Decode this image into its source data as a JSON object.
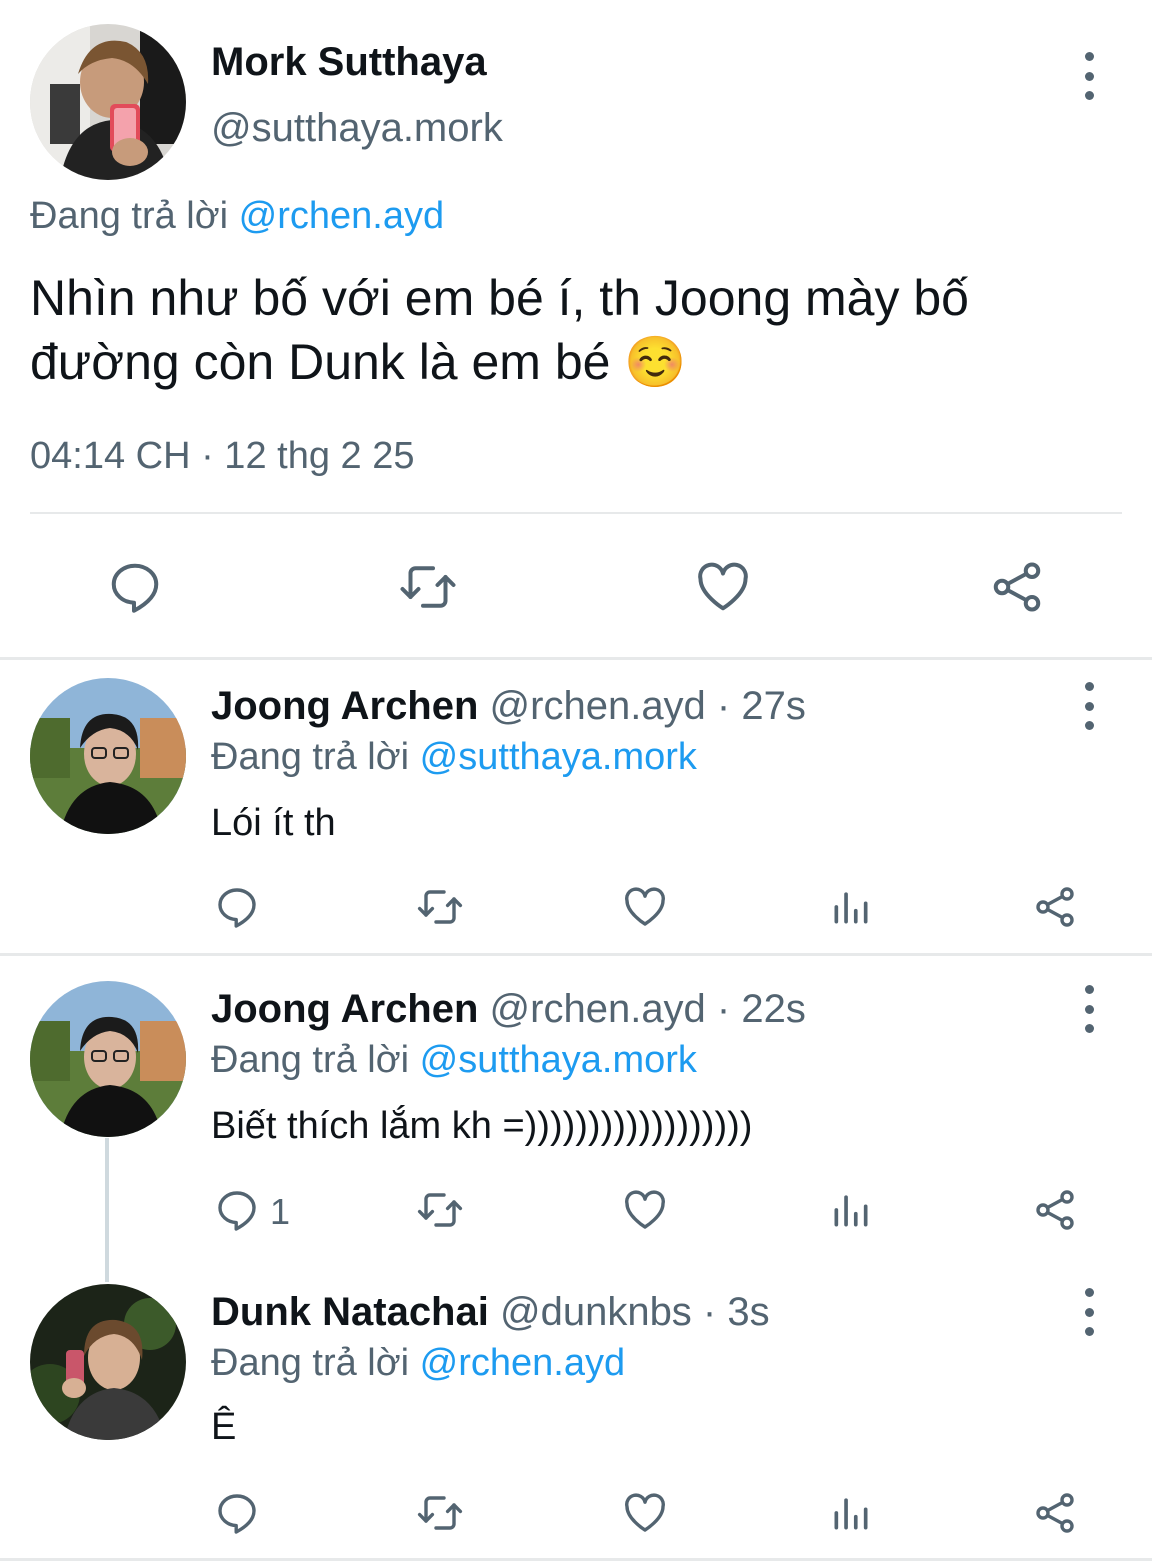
{
  "main_tweet": {
    "name": "Mork Sutthaya",
    "handle": "@sutthaya.mork",
    "replying_prefix": "Đang trả lời ",
    "replying_to": "@rchen.ayd",
    "text": "Nhìn như bố với em bé í, th Joong mày bố đường còn Dunk là em bé ☺️",
    "timestamp": "04:14 CH · 12 thg 2 25"
  },
  "replies": [
    {
      "name": "Joong Archen",
      "meta": " @rchen.ayd · 27s",
      "replying_prefix": "Đang trả lời ",
      "replying_to": "@sutthaya.mork",
      "text": "Lói ít th",
      "reply_count": ""
    },
    {
      "name": "Joong Archen",
      "meta": " @rchen.ayd · 22s",
      "replying_prefix": "Đang trả lời ",
      "replying_to": "@sutthaya.mork",
      "text": "Biết thích lắm kh =))))))))))))))))))",
      "reply_count": "1"
    },
    {
      "name": "Dunk Natachai",
      "meta": " @dunknbs · 3s",
      "replying_prefix": "Đang trả lời ",
      "replying_to": "@rchen.ayd",
      "text": "Ê",
      "reply_count": ""
    }
  ],
  "icons": {
    "reply": "reply-icon",
    "retweet": "retweet-icon",
    "like": "heart-icon",
    "views": "analytics-icon",
    "share": "share-icon",
    "more": "more-vertical-icon"
  },
  "colors": {
    "text": "#0f1419",
    "secondary": "#536471",
    "mention": "#1d9bf0",
    "divider": "#e7e9ea"
  }
}
